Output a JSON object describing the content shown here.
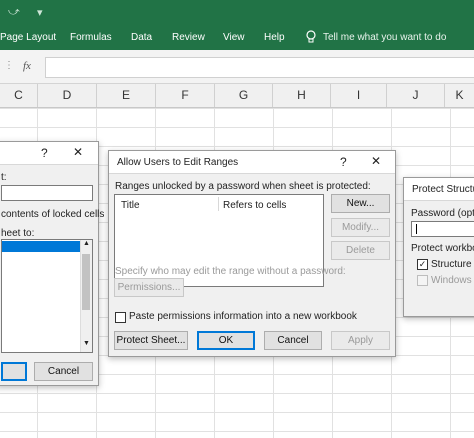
{
  "ribbon": {
    "tabs": [
      "Page Layout",
      "Formulas",
      "Data",
      "Review",
      "View",
      "Help"
    ],
    "tell_me": "Tell me what you want to do"
  },
  "formula_bar": {
    "fx": "fx"
  },
  "columns": [
    "C",
    "D",
    "E",
    "F",
    "G",
    "H",
    "I",
    "J",
    "K"
  ],
  "protect_sheet_dialog": {
    "title_help": "?",
    "title_close": "✕",
    "partial_label_1": "t:",
    "partial_label_2": "contents of locked cells",
    "partial_label_3": "heet to:",
    "ok_label": "",
    "cancel_label": "Cancel"
  },
  "allow_users_dialog": {
    "title": "Allow Users to Edit Ranges",
    "help": "?",
    "close": "✕",
    "ranges_label": "Ranges unlocked by a password when sheet is protected:",
    "columns": [
      "Title",
      "Refers to cells"
    ],
    "new_button": "New...",
    "modify_button": "Modify...",
    "delete_button": "Delete",
    "specify_label": "Specify who may edit the range without a password:",
    "permissions_button": "Permissions...",
    "paste_permissions_label": "Paste permissions information into a new workbook",
    "paste_permissions_checked": false,
    "protect_sheet_button": "Protect Sheet...",
    "ok_button": "OK",
    "cancel_button": "Cancel",
    "apply_button": "Apply"
  },
  "protect_structure_dialog": {
    "title": "Protect Structu",
    "password_label": "Password (optio",
    "protect_workbook_label": "Protect workbo",
    "structure_label": "Structure",
    "structure_checked": true,
    "windows_label": "Windows"
  }
}
